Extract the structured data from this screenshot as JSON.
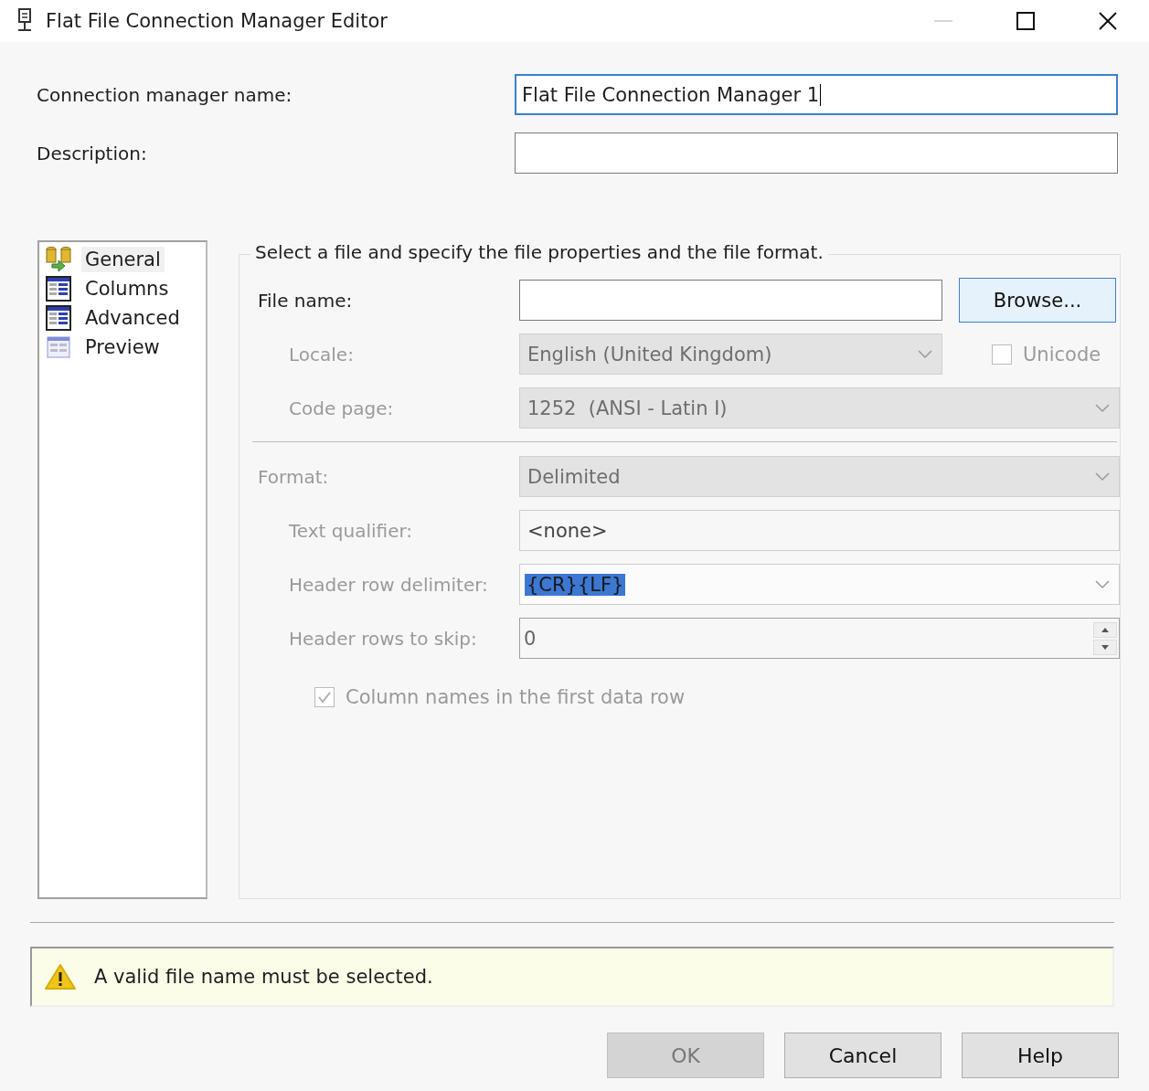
{
  "window": {
    "title": "Flat File Connection Manager Editor",
    "controls": [
      {
        "kind": "minimize",
        "disabled": true
      },
      {
        "kind": "maximize",
        "disabled": false
      },
      {
        "kind": "close",
        "disabled": false
      }
    ]
  },
  "header_fields": [
    {
      "label": "Connection manager name:",
      "value": "Flat File Connection Manager 1",
      "focused": true
    },
    {
      "label": "Description:",
      "focused": false
    }
  ],
  "nav": [
    {
      "label": "General",
      "kind": "general",
      "selected": true
    },
    {
      "label": "Columns",
      "kind": "columns",
      "selected": false
    },
    {
      "label": "Advanced",
      "kind": "columns",
      "selected": false
    },
    {
      "label": "Preview",
      "kind": "preview",
      "selected": false
    }
  ],
  "group": {
    "heading": "Select a file and specify the file properties and the file format.",
    "sections": [
      {
        "kind": "file",
        "label": "File name:",
        "disabled": false,
        "button": "Browse...",
        "children": [
          {
            "kind": "dropdown",
            "label": "Locale:",
            "value": "English (United Kingdom)",
            "disabled": true,
            "checkbox": {
              "label": "Unicode",
              "checked": false,
              "disabled": true
            }
          },
          {
            "kind": "dropdown",
            "label": "Code page:",
            "value": "1252  (ANSI - Latin I)",
            "disabled": true
          }
        ]
      },
      {
        "kind": "dropdown",
        "label": "Format:",
        "value": "Delimited",
        "disabled": true,
        "children": [
          {
            "kind": "text",
            "label": "Text qualifier:",
            "value": "<none>",
            "disabled": true
          },
          {
            "kind": "combo",
            "label": "Header row delimiter:",
            "value": "{CR}{LF}",
            "disabled": true,
            "text_selected": true
          },
          {
            "kind": "spin",
            "label": "Header rows to skip:",
            "value": "0",
            "disabled": true
          },
          {
            "kind": "checkbox",
            "label": "Column names in the first data row",
            "checked": true,
            "disabled": true
          }
        ]
      }
    ]
  },
  "message": {
    "kind": "warning",
    "text": "A valid file name must be selected."
  },
  "buttons": [
    {
      "label": "OK",
      "disabled": true
    },
    {
      "label": "Cancel",
      "disabled": false
    },
    {
      "label": "Help",
      "disabled": false
    }
  ]
}
